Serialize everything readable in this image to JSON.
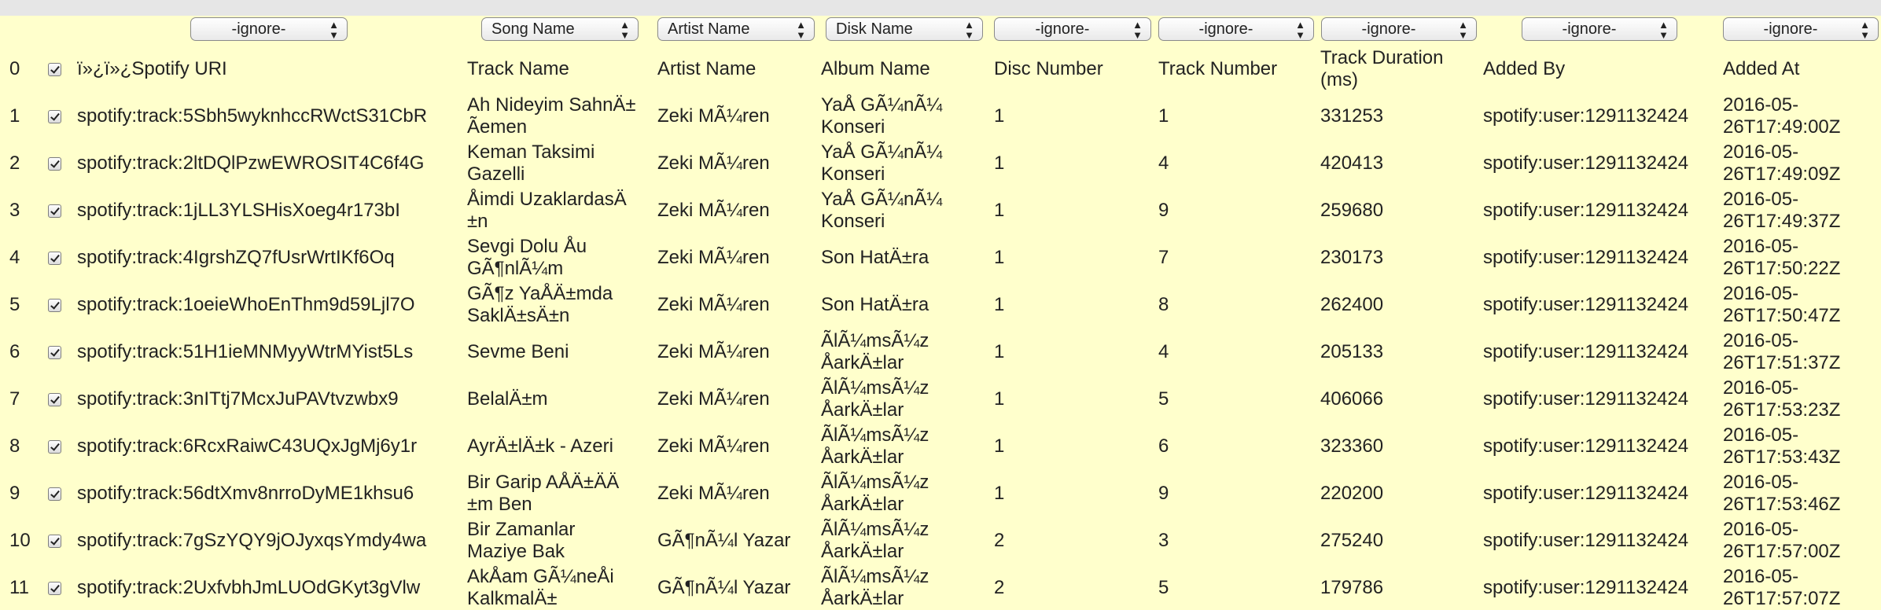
{
  "mapping_selects": [
    {
      "value": "-ignore-"
    },
    {
      "value": "Song Name"
    },
    {
      "value": "Artist Name"
    },
    {
      "value": "Disk Name"
    },
    {
      "value": "-ignore-"
    },
    {
      "value": "-ignore-"
    },
    {
      "value": "-ignore-"
    },
    {
      "value": "-ignore-"
    },
    {
      "value": "-ignore-"
    }
  ],
  "header": {
    "index": "0",
    "checked": true,
    "columns": [
      "ï»¿ï»¿Spotify URI",
      "Track Name",
      "Artist Name",
      "Album Name",
      "Disc Number",
      "Track Number",
      "Track Duration (ms)",
      "Added By",
      "Added At"
    ]
  },
  "rows": [
    {
      "index": "1",
      "checked": true,
      "uri": "spotify:track:5Sbh5wyknhccRWctS31CbR",
      "track": [
        "Ah Nideyim SahnÄ±",
        "Ãemen"
      ],
      "artist": "Zeki MÃ¼ren",
      "album": [
        "YaÅ GÃ¼nÃ¼",
        "Konseri"
      ],
      "disc": "1",
      "track_no": "1",
      "duration": "331253",
      "added_by": "spotify:user:1291132424",
      "added_at": [
        "2016-05-",
        "26T17:49:00Z"
      ]
    },
    {
      "index": "2",
      "checked": true,
      "uri": "spotify:track:2ltDQlPzwEWROSIT4C6f4G",
      "track": [
        "Keman Taksimi",
        "Gazelli"
      ],
      "artist": "Zeki MÃ¼ren",
      "album": [
        "YaÅ GÃ¼nÃ¼",
        "Konseri"
      ],
      "disc": "1",
      "track_no": "4",
      "duration": "420413",
      "added_by": "spotify:user:1291132424",
      "added_at": [
        "2016-05-",
        "26T17:49:09Z"
      ]
    },
    {
      "index": "3",
      "checked": true,
      "uri": "spotify:track:1jLL3YLSHisXoeg4r173bI",
      "track": [
        "Åimdi UzaklardasÄ",
        "±n"
      ],
      "artist": "Zeki MÃ¼ren",
      "album": [
        "YaÅ GÃ¼nÃ¼",
        "Konseri"
      ],
      "disc": "1",
      "track_no": "9",
      "duration": "259680",
      "added_by": "spotify:user:1291132424",
      "added_at": [
        "2016-05-",
        "26T17:49:37Z"
      ]
    },
    {
      "index": "4",
      "checked": true,
      "uri": "spotify:track:4IgrshZQ7fUsrWrtIKf6Oq",
      "track": [
        "Sevgi Dolu Åu",
        "GÃ¶nlÃ¼m"
      ],
      "artist": "Zeki MÃ¼ren",
      "album": [
        "Son HatÄ±ra"
      ],
      "disc": "1",
      "track_no": "7",
      "duration": "230173",
      "added_by": "spotify:user:1291132424",
      "added_at": [
        "2016-05-",
        "26T17:50:22Z"
      ]
    },
    {
      "index": "5",
      "checked": true,
      "uri": "spotify:track:1oeieWhoEnThm9d59Ljl7O",
      "track": [
        "GÃ¶z YaÅÄ±mda",
        "SaklÄ±sÄ±n"
      ],
      "artist": "Zeki MÃ¼ren",
      "album": [
        "Son HatÄ±ra"
      ],
      "disc": "1",
      "track_no": "8",
      "duration": "262400",
      "added_by": "spotify:user:1291132424",
      "added_at": [
        "2016-05-",
        "26T17:50:47Z"
      ]
    },
    {
      "index": "6",
      "checked": true,
      "uri": "spotify:track:51H1ieMNMyyWtrMYist5Ls",
      "track": [
        "Sevme Beni"
      ],
      "artist": "Zeki MÃ¼ren",
      "album": [
        "ÃlÃ¼msÃ¼z",
        "ÅarkÄ±lar"
      ],
      "disc": "1",
      "track_no": "4",
      "duration": "205133",
      "added_by": "spotify:user:1291132424",
      "added_at": [
        "2016-05-",
        "26T17:51:37Z"
      ]
    },
    {
      "index": "7",
      "checked": true,
      "uri": "spotify:track:3nITtj7McxJuPAVtvzwbx9",
      "track": [
        "BelalÄ±m"
      ],
      "artist": "Zeki MÃ¼ren",
      "album": [
        "ÃlÃ¼msÃ¼z",
        "ÅarkÄ±lar"
      ],
      "disc": "1",
      "track_no": "5",
      "duration": "406066",
      "added_by": "spotify:user:1291132424",
      "added_at": [
        "2016-05-",
        "26T17:53:23Z"
      ]
    },
    {
      "index": "8",
      "checked": true,
      "uri": "spotify:track:6RcxRaiwC43UQxJgMj6y1r",
      "track": [
        "AyrÄ±lÄ±k - Azeri"
      ],
      "artist": "Zeki MÃ¼ren",
      "album": [
        "ÃlÃ¼msÃ¼z",
        "ÅarkÄ±lar"
      ],
      "disc": "1",
      "track_no": "6",
      "duration": "323360",
      "added_by": "spotify:user:1291132424",
      "added_at": [
        "2016-05-",
        "26T17:53:43Z"
      ]
    },
    {
      "index": "9",
      "checked": true,
      "uri": "spotify:track:56dtXmv8nrroDyME1khsu6",
      "track": [
        "Bir Garip AÅÄ±ÄÄ",
        "±m Ben"
      ],
      "artist": "Zeki MÃ¼ren",
      "album": [
        "ÃlÃ¼msÃ¼z",
        "ÅarkÄ±lar"
      ],
      "disc": "1",
      "track_no": "9",
      "duration": "220200",
      "added_by": "spotify:user:1291132424",
      "added_at": [
        "2016-05-",
        "26T17:53:46Z"
      ]
    },
    {
      "index": "10",
      "checked": true,
      "uri": "spotify:track:7gSzYQY9jOJyxqsYmdy4wa",
      "track": [
        "Bir Zamanlar",
        "Maziye Bak"
      ],
      "artist": "GÃ¶nÃ¼l Yazar",
      "album": [
        "ÃlÃ¼msÃ¼z",
        "ÅarkÄ±lar"
      ],
      "disc": "2",
      "track_no": "3",
      "duration": "275240",
      "added_by": "spotify:user:1291132424",
      "added_at": [
        "2016-05-",
        "26T17:57:00Z"
      ]
    },
    {
      "index": "11",
      "checked": true,
      "uri": "spotify:track:2UxfvbhJmLUOdGKyt3gVlw",
      "track": [
        "AkÅam GÃ¼neÅi",
        "KalkmalÄ±"
      ],
      "artist": "GÃ¶nÃ¼l Yazar",
      "album": [
        "ÃlÃ¼msÃ¼z",
        "ÅarkÄ±lar"
      ],
      "disc": "2",
      "track_no": "5",
      "duration": "179786",
      "added_by": "spotify:user:1291132424",
      "added_at": [
        "2016-05-",
        "26T17:57:07Z"
      ]
    }
  ]
}
